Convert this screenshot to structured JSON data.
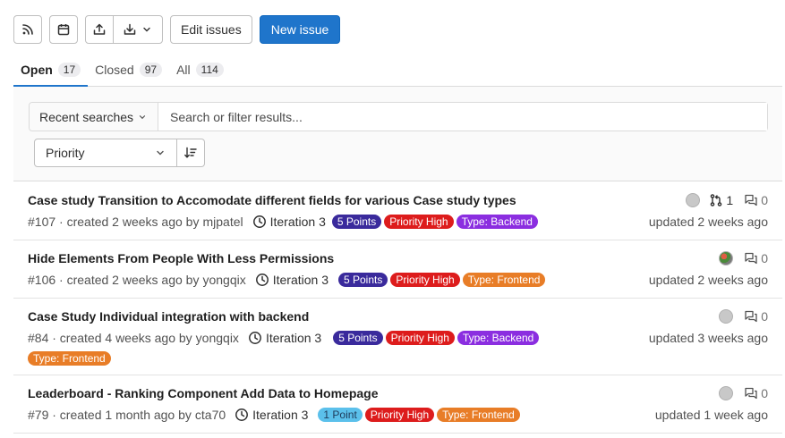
{
  "toolbar": {
    "edit_label": "Edit issues",
    "new_label": "New issue"
  },
  "tabs": [
    {
      "label": "Open",
      "count": "17"
    },
    {
      "label": "Closed",
      "count": "97"
    },
    {
      "label": "All",
      "count": "114"
    }
  ],
  "search": {
    "recent_label": "Recent searches",
    "placeholder": "Search or filter results..."
  },
  "sort": {
    "selected": "Priority"
  },
  "colors": {
    "primary": "#1f75cb",
    "points": "#3a2a9c",
    "priority_high": "#dd1c1c",
    "backend": "#8b2ee0",
    "frontend": "#e87d27",
    "one_point": "#5bc0eb"
  },
  "issues": [
    {
      "title": "Case study Transition to Accomodate different fields for various Case study types",
      "ref": "#107",
      "created": "· created 2 weeks ago by",
      "author": "mjpatel",
      "iteration": "Iteration 3",
      "labels": [
        "5 Points",
        "Priority High",
        "Type: Backend"
      ],
      "mr_count": "1",
      "comments": "0",
      "updated": "updated 2 weeks ago"
    },
    {
      "title": "Hide Elements From People With Less Permissions",
      "ref": "#106",
      "created": "· created 2 weeks ago by",
      "author": "yongqix",
      "iteration": "Iteration 3",
      "labels": [
        "5 Points",
        "Priority High",
        "Type: Frontend"
      ],
      "comments": "0",
      "updated": "updated 2 weeks ago"
    },
    {
      "title": "Case Study Individual integration with backend",
      "ref": "#84",
      "created": "· created 4 weeks ago by",
      "author": "yongqix",
      "iteration": "Iteration 3",
      "labels": [
        "5 Points",
        "Priority High",
        "Type: Backend"
      ],
      "extra_label": "Type: Frontend",
      "comments": "0",
      "updated": "updated 3 weeks ago"
    },
    {
      "title": "Leaderboard - Ranking Component Add Data to Homepage",
      "ref": "#79",
      "created": "· created 1 month ago by",
      "author": "cta70",
      "iteration": "Iteration 3",
      "labels": [
        "1 Point",
        "Priority High",
        "Type: Frontend"
      ],
      "comments": "0",
      "updated": "updated 1 week ago"
    }
  ]
}
